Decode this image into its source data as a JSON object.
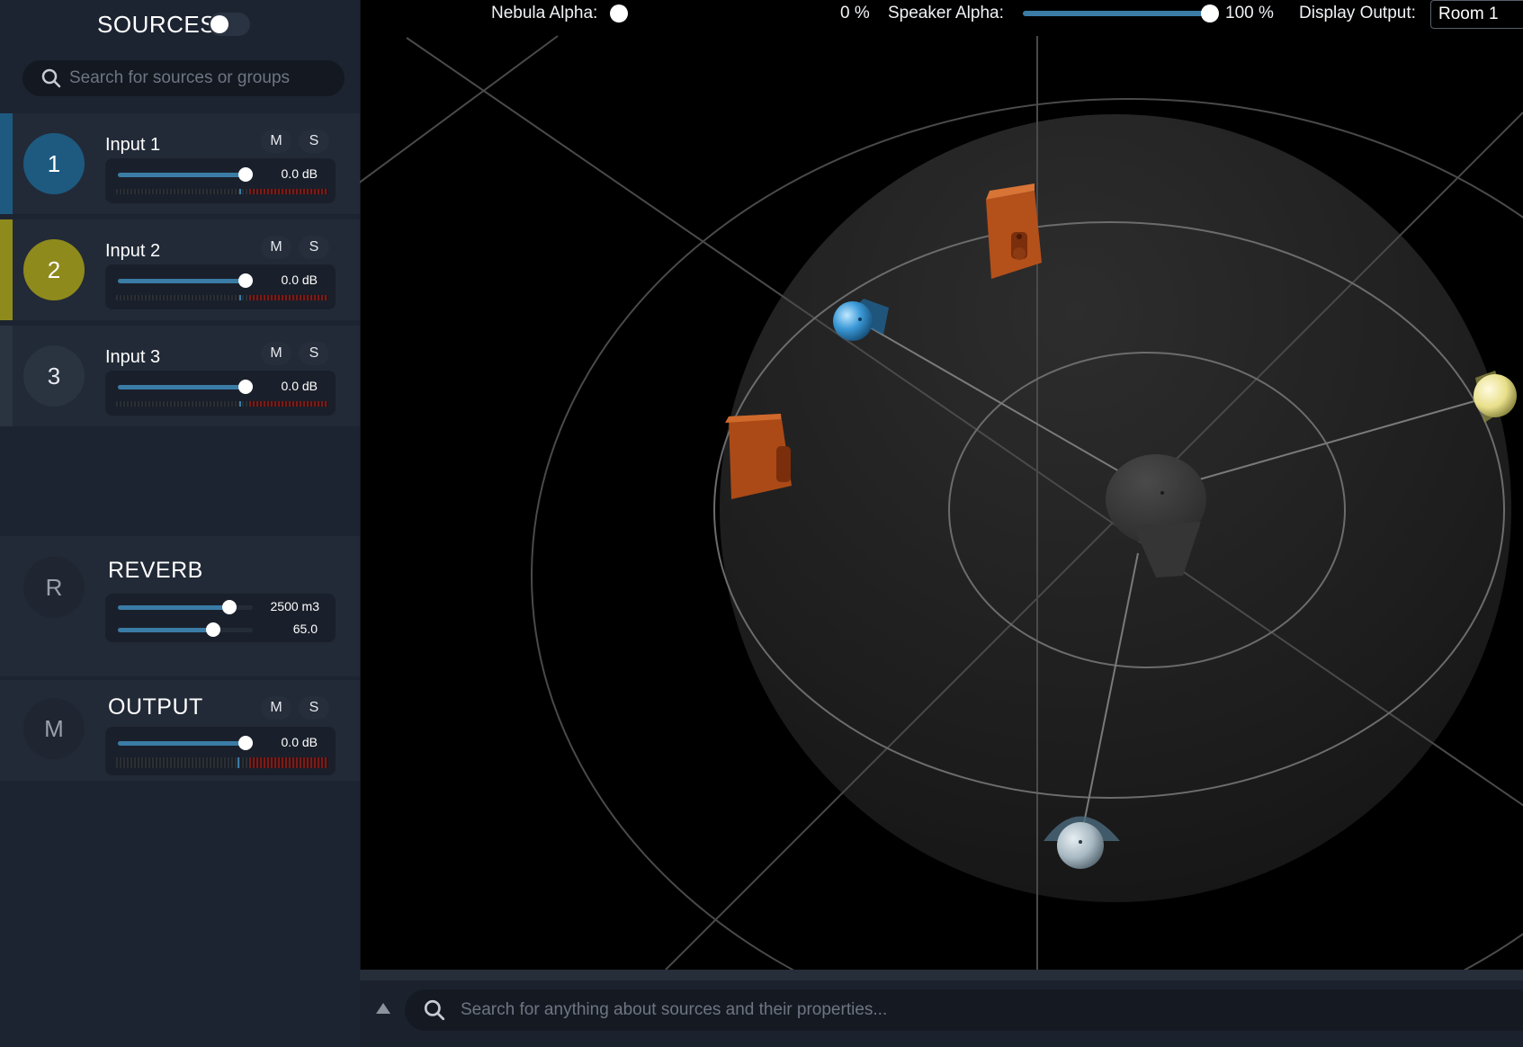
{
  "sidebar": {
    "title": "SOURCES",
    "search_placeholder": "Search for sources or groups",
    "inputs": [
      {
        "number": "1",
        "name": "Input 1",
        "mute": "M",
        "solo": "S",
        "gain": "0.0 dB",
        "color": "#1e5a80",
        "level": 0.8
      },
      {
        "number": "2",
        "name": "Input 2",
        "mute": "M",
        "solo": "S",
        "gain": "0.0 dB",
        "color": "#8f8a1c",
        "level": 0.8
      },
      {
        "number": "3",
        "name": "Input 3",
        "mute": "M",
        "solo": "S",
        "gain": "0.0 dB",
        "color": "#2a3340",
        "level": 0.8
      }
    ],
    "reverb": {
      "letter": "R",
      "name": "REVERB",
      "room_volume": "2500 m3",
      "reverb_value": "65.0",
      "room_level": 0.85,
      "reverb_level": 0.71
    },
    "output": {
      "letter": "M",
      "name": "OUTPUT",
      "mute": "M",
      "solo": "S",
      "gain": "0.0 dB",
      "level": 0.8
    }
  },
  "topbar": {
    "nebula_label": "Nebula Alpha:",
    "nebula_value": "0 %",
    "speaker_label": "Speaker Alpha:",
    "speaker_value": "100 %",
    "speaker_level": 1.0,
    "display_output_label": "Display Output:",
    "display_output_value": "Room 1"
  },
  "bottom": {
    "search_placeholder": "Search for anything about sources and their properties..."
  },
  "colors": {
    "accent_blue": "#3a7ca6",
    "input1": "#1e5a80",
    "input2": "#8f8a1c",
    "speaker": "#c8561a"
  }
}
